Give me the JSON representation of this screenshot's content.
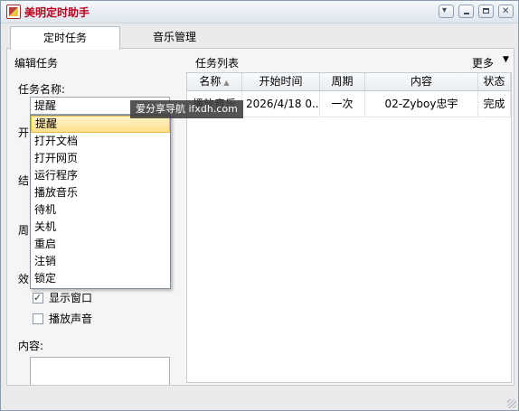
{
  "window": {
    "title": "美明定时助手",
    "accent": "#b8001e"
  },
  "tabs": [
    {
      "label": "定时任务",
      "active": true
    },
    {
      "label": "音乐管理",
      "active": false
    }
  ],
  "left": {
    "section_title": "编辑任务",
    "task_name_label": "任务名称:",
    "selected_value": "提醒",
    "tooltip": "爱分享导航 ifxdh.com",
    "partial_labels": [
      "开",
      "结",
      "周",
      "效"
    ],
    "dropdown_options": [
      "提醒",
      "打开文档",
      "打开网页",
      "运行程序",
      "播放音乐",
      "待机",
      "关机",
      "重启",
      "注销",
      "锁定"
    ],
    "checkboxes": [
      {
        "label": "显示窗口",
        "checked": true
      },
      {
        "label": "播放声音",
        "checked": false
      }
    ],
    "content_label": "内容:"
  },
  "right": {
    "list_title": "任务列表",
    "more_label": "更多",
    "columns": [
      "名称",
      "开始时间",
      "周期",
      "内容",
      "状态"
    ],
    "rows": [
      {
        "name": "播放音乐",
        "start": "2026/4/18 0...",
        "cycle": "一次",
        "content": "02-Zyboy忠宇",
        "status": "完成"
      }
    ]
  },
  "icons": {
    "app": "alarm-clock-icon",
    "dropdown": "chevron-down-icon",
    "minimize": "minimize-icon",
    "maximize": "maximize-icon",
    "close": "close-icon"
  }
}
